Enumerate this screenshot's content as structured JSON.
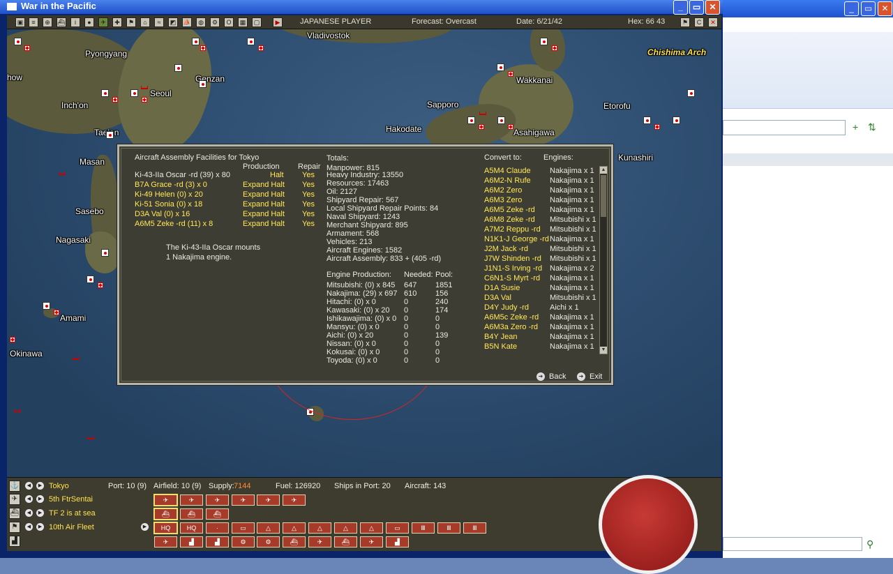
{
  "window": {
    "title": "War in the Pacific"
  },
  "toolbar": {
    "player": "JAPANESE PLAYER",
    "forecast": "Forecast: Overcast",
    "date": "Date: 6/21/42",
    "hex": "Hex: 66 43",
    "icons": [
      "map-icon",
      "list-icon",
      "group-icon",
      "ship-icon",
      "info-icon",
      "flag-icon",
      "plane-icon",
      "cross-icon",
      "flag2-icon",
      "unit-icon",
      "sub-icon",
      "swap-icon",
      "fleet-icon",
      "globe-icon",
      "gear-icon",
      "op-icon",
      "table-icon",
      "screen-icon",
      "play-icon"
    ]
  },
  "map": {
    "labels": {
      "vladivostok": "Vladivostok",
      "chishima": "Chishima Arch",
      "pyongyang": "Pyongyang",
      "wakkanai": "Wakkanai",
      "genzan": "Genzan",
      "seoul": "Seoul",
      "show": "how",
      "inchon": "Inch'on",
      "sapporo": "Sapporo",
      "etorofu": "Etorofu",
      "hakodate": "Hakodate",
      "asahigawa": "Asahigawa",
      "taejon": "Taejon",
      "kunashiri": "Kunashiri",
      "masan": "Masan",
      "sasebo": "Sasebo",
      "nagasaki": "Nagasaki",
      "amami": "Amami",
      "okinawa": "Okinawa"
    }
  },
  "panel": {
    "title": "Aircraft Assembly Facilities for Tokyo",
    "col_production": "Production",
    "col_repair": "Repair",
    "aircraft": [
      {
        "name": "Ki-43-IIa Oscar -rd   (39) x 80",
        "production": "Halt",
        "repair": "Yes",
        "highlight": false
      },
      {
        "name": "B7A Grace -rd   (3) x 0",
        "production": "Expand Halt",
        "repair": "Yes",
        "highlight": true
      },
      {
        "name": "Ki-49 Helen   (0) x 20",
        "production": "Expand Halt",
        "repair": "Yes",
        "highlight": true
      },
      {
        "name": "Ki-51 Sonia   (0) x 18",
        "production": "Expand Halt",
        "repair": "Yes",
        "highlight": true
      },
      {
        "name": "D3A Val   (0) x 16",
        "production": "Expand Halt",
        "repair": "Yes",
        "highlight": true
      },
      {
        "name": "A6M5 Zeke -rd   (11) x 8",
        "production": "Expand Halt",
        "repair": "Yes",
        "highlight": true
      }
    ],
    "note_line1": "The Ki-43-IIa Oscar mounts",
    "note_line2": "1  Nakajima engine.",
    "totals_title": "Totals:",
    "totals": [
      "Manpower: 815",
      "Heavy Industry: 13550",
      "Resources: 17463",
      "Oil: 2127",
      "Shipyard Repair: 567",
      "Local Shipyard Repair Points: 84",
      "Naval Shipyard: 1243",
      "Merchant Shipyard: 895",
      "Armament: 568",
      "Vehicles: 213",
      "Aircraft Engines: 1582",
      "Aircraft Assembly: 833 + (405 -rd)"
    ],
    "engine_header": {
      "production": "Engine Production:",
      "needed": "Needed:",
      "pool": "Pool:"
    },
    "engines": [
      {
        "name": "Mitsubishi:  (0) x 845",
        "needed": "647",
        "pool": "1851"
      },
      {
        "name": "Nakajima:  (29) x 697",
        "needed": "610",
        "pool": "156"
      },
      {
        "name": "Hitachi:   (0) x 0",
        "needed": "0",
        "pool": "240"
      },
      {
        "name": "Kawasaki:   (0) x 20",
        "needed": "0",
        "pool": "174"
      },
      {
        "name": "Ishikawajima:   (0) x 0",
        "needed": "0",
        "pool": "0"
      },
      {
        "name": "Mansyu:   (0) x 0",
        "needed": "0",
        "pool": "0"
      },
      {
        "name": "Aichi:   (0) x 20",
        "needed": "0",
        "pool": "139"
      },
      {
        "name": "Nissan:   (0) x 0",
        "needed": "0",
        "pool": "0"
      },
      {
        "name": "Kokusai:   (0) x 0",
        "needed": "0",
        "pool": "0"
      },
      {
        "name": "Toyoda:   (0) x 0",
        "needed": "0",
        "pool": "0"
      }
    ],
    "convert_title": "Convert to:",
    "engines_title": "Engines:",
    "converts": [
      {
        "name": "A5M4 Claude",
        "engine": "Nakajima x 1"
      },
      {
        "name": "A6M2-N Rufe",
        "engine": "Nakajima x 1"
      },
      {
        "name": "A6M2 Zero",
        "engine": "Nakajima x 1"
      },
      {
        "name": "A6M3 Zero",
        "engine": "Nakajima x 1"
      },
      {
        "name": "A6M5 Zeke -rd",
        "engine": "Nakajima x 1"
      },
      {
        "name": "A6M8 Zeke -rd",
        "engine": "Mitsubishi x 1"
      },
      {
        "name": "A7M2 Reppu -rd",
        "engine": "Mitsubishi x 1"
      },
      {
        "name": "N1K1-J George -rd",
        "engine": "Nakajima x 1"
      },
      {
        "name": "J2M Jack -rd",
        "engine": "Mitsubishi x 1"
      },
      {
        "name": "J7W Shinden -rd",
        "engine": "Mitsubishi x 1"
      },
      {
        "name": "J1N1-S Irving -rd",
        "engine": "Nakajima x 2"
      },
      {
        "name": "C6N1-S Myrt -rd",
        "engine": "Nakajima x 1"
      },
      {
        "name": "D1A Susie",
        "engine": "Nakajima x 1"
      },
      {
        "name": "D3A Val",
        "engine": "Mitsubishi x 1"
      },
      {
        "name": "D4Y Judy -rd",
        "engine": "Aichi x 1"
      },
      {
        "name": "A6M5c Zeke -rd",
        "engine": "Nakajima x 1"
      },
      {
        "name": "A6M3a Zero -rd",
        "engine": "Nakajima x 1"
      },
      {
        "name": "B4Y Jean",
        "engine": "Nakajima x 1"
      },
      {
        "name": "B5N Kate",
        "engine": "Nakajima x 1"
      }
    ],
    "back": "Back",
    "exit": "Exit"
  },
  "bottom": {
    "base_name": "Tokyo",
    "port": "Port: 10 (9)",
    "airfield": "Airfield: 10 (9)",
    "supply_label": "Supply:",
    "supply_value": "7144",
    "fuel": "Fuel: 126920",
    "ships": "Ships in Port: 20",
    "aircraft": "Aircraft: 143",
    "row2": "5th FtrSentai",
    "row3": "TF 2 is at sea",
    "row4": "10th Air Fleet",
    "hq_label": "HQ",
    "colors": {
      "accent_yellow": "#ffe24a",
      "button_red": "#a63b2a",
      "supply": "#ff8c3a"
    }
  }
}
